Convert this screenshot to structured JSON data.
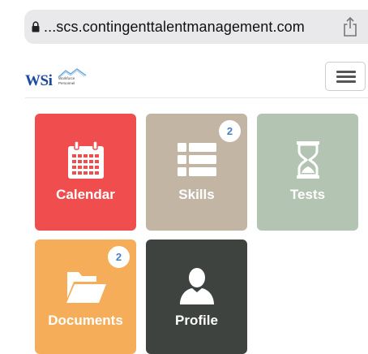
{
  "browser": {
    "url": "...scs.contingenttalentmanagement.com",
    "lock_icon": "lock-icon",
    "share_icon": "share-icon"
  },
  "header": {
    "logo_text": "WSi",
    "logo_tagline_1": "Workforce",
    "logo_tagline_2": "Personnel",
    "menu_icon": "hamburger-menu-icon"
  },
  "tiles": [
    {
      "label": "Calendar",
      "icon": "calendar-icon",
      "color": "#f04e4e",
      "badge": ""
    },
    {
      "label": "Skills",
      "icon": "list-icon",
      "color": "#c3b5a4",
      "badge": "2"
    },
    {
      "label": "Tests",
      "icon": "hourglass-icon",
      "color": "#b3c4b3",
      "badge": ""
    },
    {
      "label": "Documents",
      "icon": "folder-open-icon",
      "color": "#f5ad5a",
      "badge": "2"
    },
    {
      "label": "Profile",
      "icon": "user-icon",
      "color": "#3f4340",
      "badge": ""
    }
  ]
}
